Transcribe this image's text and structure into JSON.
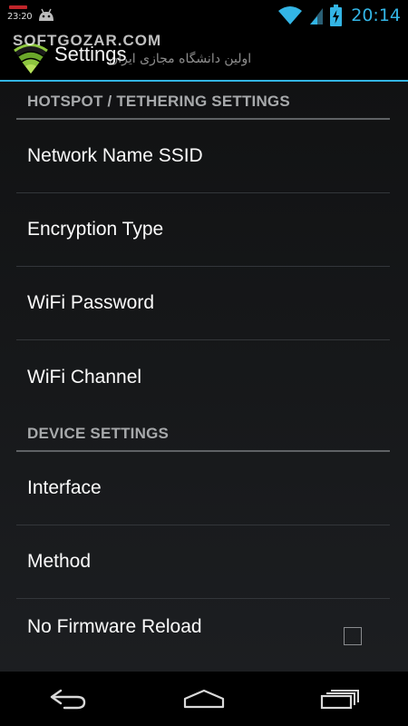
{
  "status_bar": {
    "notification_time": "23:20",
    "clock": "20:14",
    "icons": [
      "notification-icon",
      "android-icon",
      "wifi-icon",
      "signal-icon",
      "battery-charging-icon"
    ],
    "accent": "#33b5e5"
  },
  "action_bar": {
    "title": "Settings",
    "app_icon": "wifi-hotspot-icon",
    "watermark": "SOFTGOZAR.COM",
    "watermark_subtitle": "اولین دانشگاه مجازی ایران"
  },
  "sections": [
    {
      "header": "HOTSPOT / TETHERING SETTINGS",
      "items": [
        {
          "label": "Network Name SSID"
        },
        {
          "label": "Encryption Type"
        },
        {
          "label": "WiFi Password"
        },
        {
          "label": "WiFi Channel"
        }
      ]
    },
    {
      "header": "DEVICE SETTINGS",
      "items": [
        {
          "label": "Interface"
        },
        {
          "label": "Method"
        },
        {
          "label": "No Firmware Reload",
          "checkbox": true,
          "checked": false
        }
      ]
    }
  ],
  "nav_bar": {
    "icons": [
      "back-icon",
      "home-icon",
      "recent-apps-icon"
    ]
  }
}
